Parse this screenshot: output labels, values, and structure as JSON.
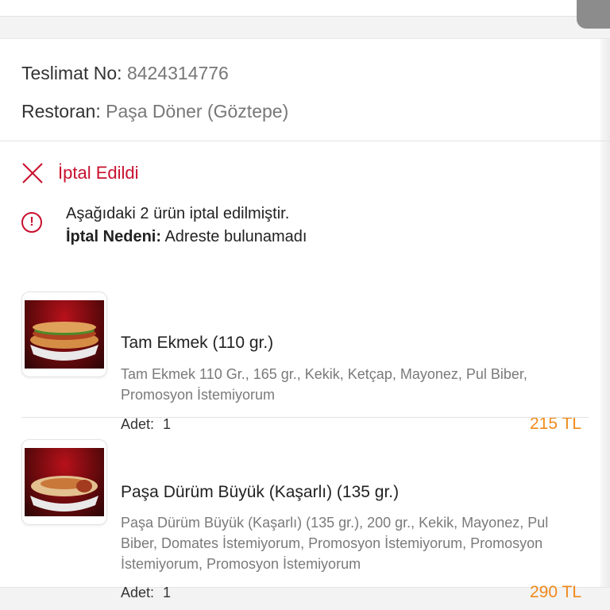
{
  "order": {
    "delivery_label": "Teslimat No:",
    "delivery_no": "8424314776",
    "restaurant_label": "Restoran:",
    "restaurant_name": "Paşa Döner (Göztepe)"
  },
  "status": {
    "text": "İptal Edildi",
    "icon": "close-icon",
    "color": "#c8102e"
  },
  "notice": {
    "icon": "info-icon",
    "line1": "Aşağıdaki 2 ürün iptal edilmiştir.",
    "reason_label": "İptal Nedeni:",
    "reason_value": "Adreste bulunamadı"
  },
  "items": [
    {
      "name": "Tam Ekmek (110 gr.)",
      "desc": "Tam Ekmek 110 Gr., 165 gr., Kekik, Ketçap, Mayonez, Pul Biber, Promosyon İstemiyorum",
      "qty_label": "Adet:",
      "qty": "1",
      "price": "215 TL"
    },
    {
      "name": "Paşa Dürüm Büyük (Kaşarlı) (135 gr.)",
      "desc": "Paşa Dürüm Büyük (Kaşarlı) (135 gr.), 200 gr., Kekik, Mayonez, Pul Biber, Domates İstemiyorum, Promosyon İstemiyorum, Promosyon İstemiyorum, Promosyon İstemiyorum",
      "qty_label": "Adet:",
      "qty": "1",
      "price": "290 TL"
    }
  ],
  "colors": {
    "accent_price": "#f08a1c",
    "cancel_red": "#c8102e"
  }
}
